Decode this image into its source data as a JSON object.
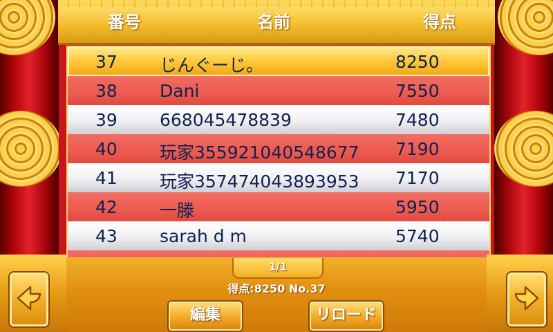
{
  "header": {
    "col_number": "番号",
    "col_name": "名前",
    "col_score": "得点"
  },
  "rows": [
    {
      "no": "37",
      "name": "じんぐーじ。",
      "score": "8250",
      "style": "selected"
    },
    {
      "no": "38",
      "name": "Dani",
      "score": "7550",
      "style": "red"
    },
    {
      "no": "39",
      "name": "668045478839",
      "score": "7480",
      "style": "white"
    },
    {
      "no": "40",
      "name": "玩家355921040548677",
      "score": "7190",
      "style": "red"
    },
    {
      "no": "41",
      "name": "玩家357474043893953",
      "score": "7170",
      "style": "white"
    },
    {
      "no": "42",
      "name": "一滕",
      "score": "5950",
      "style": "red"
    },
    {
      "no": "43",
      "name": "sarah d m",
      "score": "5740",
      "style": "white"
    }
  ],
  "footer": {
    "page": "1/1",
    "status": "得点:8250  No.37",
    "edit_label": "編集",
    "reload_label": "リロード"
  },
  "colors": {
    "accent_gold": "#f3b02a",
    "row_red": "#ec5a50",
    "text_navy": "#0f2350"
  },
  "icons": {
    "left_nav": "arrow-left-icon",
    "right_nav": "arrow-right-icon"
  }
}
